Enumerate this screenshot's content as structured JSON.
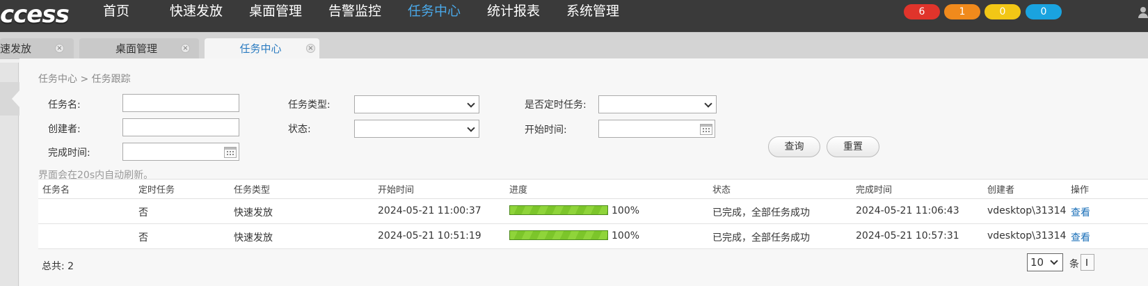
{
  "app": {
    "logo_text": "ccess"
  },
  "nav": {
    "items": [
      "首页",
      "快速发放",
      "桌面管理",
      "告警监控",
      "任务中心",
      "统计报表",
      "系统管理"
    ],
    "active": "任务中心"
  },
  "badges": [
    {
      "value": "6",
      "color": "#e0342b"
    },
    {
      "value": "1",
      "color": "#f08a1c"
    },
    {
      "value": "0",
      "color": "#f2c716"
    },
    {
      "value": "0",
      "color": "#1aa3df"
    }
  ],
  "tabs": [
    {
      "label": "速发放"
    },
    {
      "label": "桌面管理"
    },
    {
      "label": "任务中心",
      "active": true
    }
  ],
  "breadcrumb": "任务中心 > 任务跟踪",
  "filters": {
    "task_name_label": "任务名:",
    "task_type_label": "任务类型:",
    "scheduled_label": "是否定时任务:",
    "creator_label": "创建者:",
    "status_label": "状态:",
    "start_time_label": "开始时间:",
    "finish_time_label": "完成时间:",
    "task_name_value": "",
    "creator_value": "",
    "start_time_value": "",
    "finish_time_value": "",
    "task_type_value": "",
    "status_value": "",
    "scheduled_value": ""
  },
  "buttons": {
    "search": "查询",
    "reset": "重置"
  },
  "notice": "界面会在20s内自动刷新。",
  "table": {
    "headers": [
      "任务名",
      "定时任务",
      "任务类型",
      "开始时间",
      "进度",
      "状态",
      "完成时间",
      "创建者",
      "操作"
    ],
    "rows": [
      {
        "name": "",
        "scheduled": "否",
        "type": "快速发放",
        "start": "2024-05-21 11:00:37",
        "progress": 100,
        "progress_label": "100%",
        "status": "已完成，全部任务成功",
        "finish": "2024-05-21 11:06:43",
        "creator": "vdesktop\\31314",
        "action": "查看"
      },
      {
        "name": "",
        "scheduled": "否",
        "type": "快速发放",
        "start": "2024-05-21 10:51:19",
        "progress": 100,
        "progress_label": "100%",
        "status": "已完成，全部任务成功",
        "finish": "2024-05-21 10:57:31",
        "creator": "vdesktop\\31314",
        "action": "查看"
      }
    ]
  },
  "pagination": {
    "total_label": "总共: 2",
    "page_size": "10",
    "per_label": "条"
  }
}
